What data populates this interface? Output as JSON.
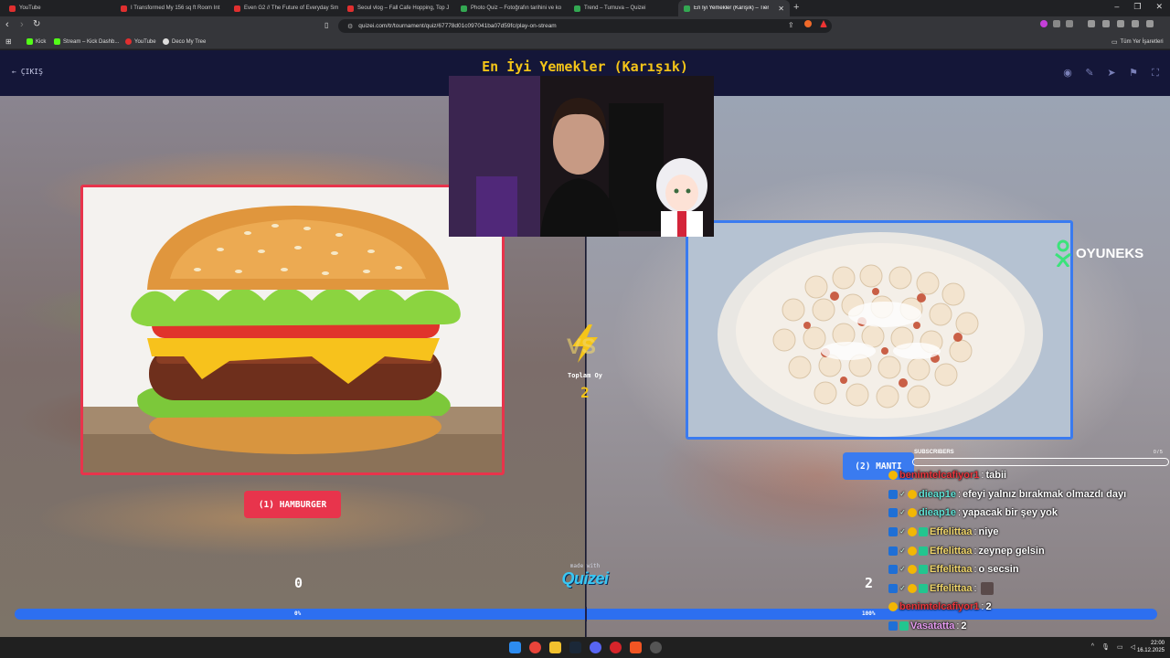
{
  "browser": {
    "tabs": [
      {
        "label": "YouTube",
        "favicon_color": "#e02f2f"
      },
      {
        "label": "I Transformed My 156 sq ft Room Int",
        "favicon_color": "#e02f2f"
      },
      {
        "label": "Even G2 // The Future of Everyday Sm",
        "favicon_color": "#e02f2f"
      },
      {
        "label": "Seoul vlog – Fall Cafe Hopping, Top J",
        "favicon_color": "#e02f2f"
      },
      {
        "label": "Photo Quiz – Fotoğrafın tarihini ve ko",
        "favicon_color": "#33a852"
      },
      {
        "label": "Trend – Turnuva – Quizei",
        "favicon_color": "#33a852"
      },
      {
        "label": "En İyi Yemekler (Karışık) – Tier Lis",
        "favicon_color": "#33a852"
      }
    ],
    "url": "quizei.com/tr/tournament/quiz/67778d01c097041ba07d59fc/play-on-stream",
    "bookmarks": [
      {
        "label": "Kick",
        "icon_color": "#53fc18"
      },
      {
        "label": "Stream – Kick Dashb...",
        "icon_color": "#53fc18"
      },
      {
        "label": "YouTube",
        "icon_color": "#e02f2f"
      },
      {
        "label": "Deco My Tree",
        "icon_color": "#dddddd"
      }
    ],
    "all_bookmarks_label": "Tüm Yer İşaretleri"
  },
  "quiz": {
    "exit_label": "ÇIKIŞ",
    "title": "En İyi Yemekler (Karışık)",
    "left_choice": {
      "label": "(1) HAMBURGER",
      "votes": "0",
      "percent": "0%",
      "percent_value": 0
    },
    "right_choice": {
      "label": "(2) MANTI",
      "votes": "2",
      "percent": "100%"
    },
    "total_votes_label": "Toplam Oy",
    "total_votes": "2",
    "made_with": "made with",
    "logo": "Quizei",
    "colors": {
      "left": "#e8344c",
      "right": "#3a7bf0",
      "accent": "#f5c518"
    }
  },
  "overlay": {
    "brand": "OYUNEKS",
    "subscribers_label": "SUBSCRIBERS",
    "subscribers_count": "0 / 5",
    "chat": [
      {
        "user": "benimtelcafiyor1",
        "color": "#e8343c",
        "badges": [
          "coin"
        ],
        "message": "tabii"
      },
      {
        "user": "dieap1e",
        "color": "#5fe3d6",
        "badges": [
          "prime",
          "check",
          "coin"
        ],
        "message": "efeyi yalnız bırakmak olmazdı dayı"
      },
      {
        "user": "dieap1e",
        "color": "#5fe3d6",
        "badges": [
          "prime",
          "check",
          "coin"
        ],
        "message": "yapacak bir şey yok"
      },
      {
        "user": "Effelittaa",
        "color": "#f0d66b",
        "badges": [
          "prime",
          "check",
          "coin",
          "gift"
        ],
        "message": "niye"
      },
      {
        "user": "Effelittaa",
        "color": "#f0d66b",
        "badges": [
          "prime",
          "check",
          "coin",
          "gift"
        ],
        "message": "zeynep gelsin"
      },
      {
        "user": "Effelittaa",
        "color": "#f0d66b",
        "badges": [
          "prime",
          "check",
          "coin",
          "gift"
        ],
        "message": "o secsin"
      },
      {
        "user": "Effelittaa",
        "color": "#f0d66b",
        "badges": [
          "prime",
          "check",
          "coin",
          "gift"
        ],
        "message": ""
      },
      {
        "user": "benimtelcafiyor1",
        "color": "#e8343c",
        "badges": [
          "coin"
        ],
        "message": "2"
      },
      {
        "user": "Vasatatta",
        "color": "#e69bf0",
        "badges": [
          "prime",
          "gift"
        ],
        "message": "2"
      }
    ]
  },
  "taskbar": {
    "time": "22:00",
    "date": "16.12.2025"
  }
}
